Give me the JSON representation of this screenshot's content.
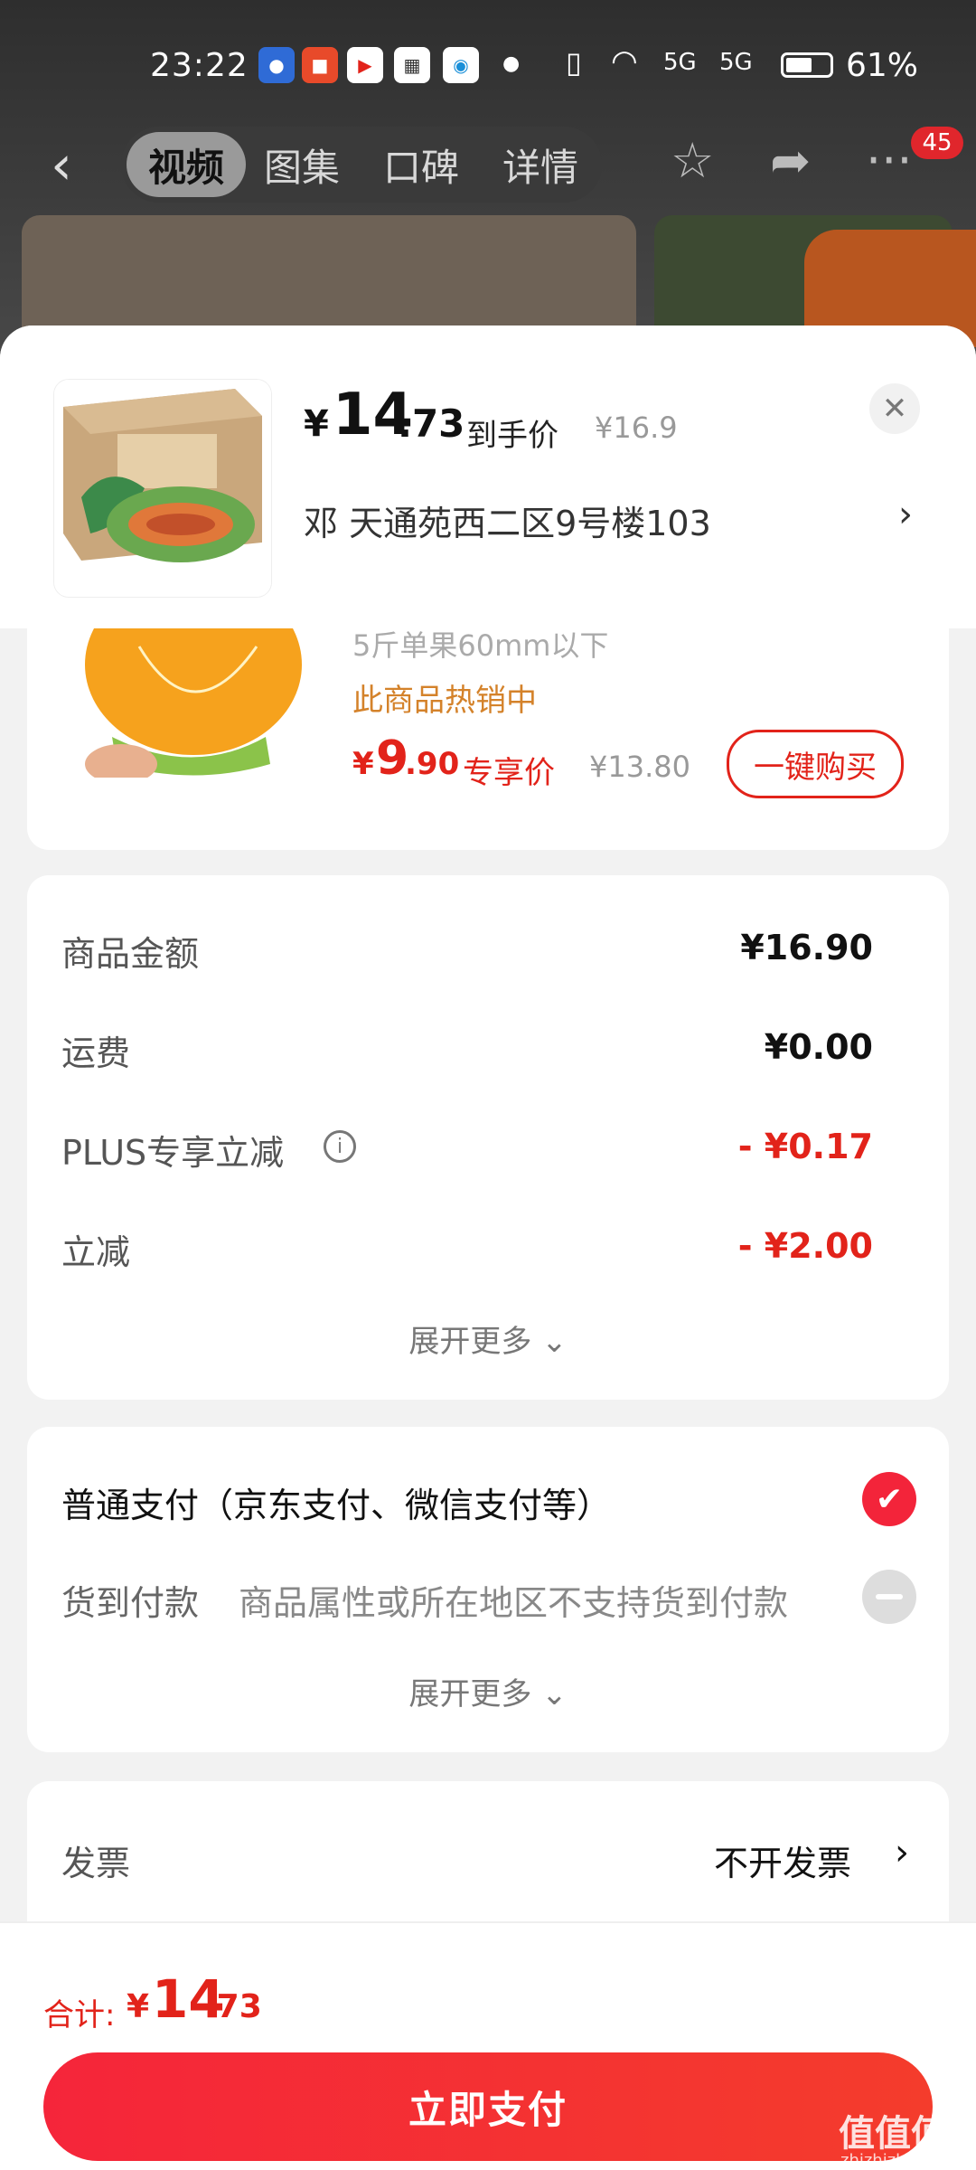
{
  "status_bar": {
    "time": "23:22",
    "signal_1": "5G",
    "signal_2": "5G",
    "battery_percent": "61%"
  },
  "nav": {
    "tabs": [
      {
        "label": "视频"
      },
      {
        "label": "图集"
      },
      {
        "label": "口碑"
      },
      {
        "label": "详情"
      }
    ],
    "badge_count": "45"
  },
  "sheet": {
    "price_currency": "¥",
    "price_int": "14",
    "price_dec": ".73",
    "price_label": "到手价",
    "original_price": "¥16.9",
    "address": "邓  天通苑西二区9号楼103"
  },
  "recommend": {
    "cut_text": "5斤单果60mm以下",
    "hot_text": "此商品热销中",
    "price_currency": "¥",
    "price_int": "9",
    "price_dec": ".90",
    "price_label": "专享价",
    "original_price": "¥13.80",
    "buy_label": "一键购买"
  },
  "amounts": {
    "rows": [
      {
        "label": "商品金额",
        "value": "¥16.90"
      },
      {
        "label": "运费",
        "value": "¥0.00"
      },
      {
        "label": "PLUS专享立减",
        "value": "- ¥0.17"
      },
      {
        "label": "立减",
        "value": "- ¥2.00"
      }
    ],
    "expand_label": "展开更多"
  },
  "payment": {
    "normal_label": "普通支付（京东支付、微信支付等）",
    "cod_label": "货到付款",
    "cod_note": "商品属性或所在地区不支持货到付款",
    "expand_label": "展开更多"
  },
  "invoice": {
    "label": "发票",
    "value": "不开发票"
  },
  "footer": {
    "total_label": "合计:",
    "total_currency": "¥",
    "total_int": "14",
    "total_dec": ".73",
    "pay_label": "立即支付",
    "watermark": "值值值",
    "watermark_sub": "zhizhizhi.com"
  },
  "colors": {
    "accent_red": "#e2231a",
    "pay_button": "#f5253a",
    "hot_orange": "#d4822a"
  }
}
